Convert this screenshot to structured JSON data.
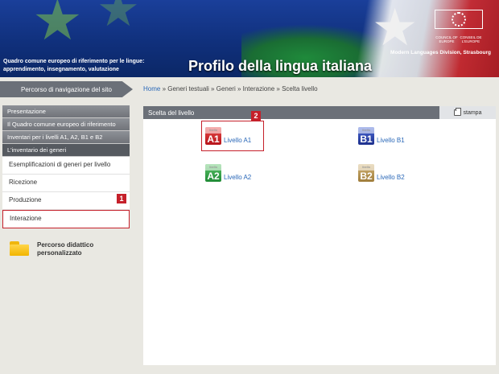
{
  "header": {
    "subtitle_line1": "Quadro comune europeo di riferimento per le lingue:",
    "subtitle_line2": "apprendimento, insegnamento, valutazione",
    "title": "Profilo della lingua italiana",
    "division": "Modern Languages Division, Strasbourg",
    "coe_left": "COUNCIL OF EUROPE",
    "coe_right": "CONSEIL DE L'EUROPE"
  },
  "nav": {
    "title": "Percorso di navigazione del sito",
    "breadcrumb": {
      "home": "Home",
      "rest": " » Generi testuali » Generi » Interazione » Scelta livello"
    }
  },
  "sidebar": {
    "items": [
      {
        "label": "Presentazione"
      },
      {
        "label": "Il Quadro comune europeo di riferimento"
      },
      {
        "label": "Inventari per i livelli A1, A2, B1 e B2"
      },
      {
        "label": "L'inventario dei generi"
      }
    ],
    "subitems": [
      {
        "label": "Esemplificazioni di generi per livello"
      },
      {
        "label": "Ricezione"
      },
      {
        "label": "Produzione"
      },
      {
        "label": "Interazione"
      }
    ],
    "folder_label": "Percorso didattico personalizzato"
  },
  "main": {
    "panel_title": "Scelta del livello",
    "print_label": "stampa",
    "levels": [
      {
        "code": "A1",
        "label": "Livello A1",
        "color": "#c5202a"
      },
      {
        "code": "B1",
        "label": "Livello B1",
        "color": "#1c2f8c"
      },
      {
        "code": "A2",
        "label": "Livello A2",
        "color": "#1f8a35"
      },
      {
        "code": "B2",
        "label": "Livello B2",
        "color": "#9f7c3a"
      }
    ],
    "level_small_text": "livello"
  },
  "annotations": {
    "badge1": "1",
    "badge2": "2",
    "color": "#c5202a"
  }
}
